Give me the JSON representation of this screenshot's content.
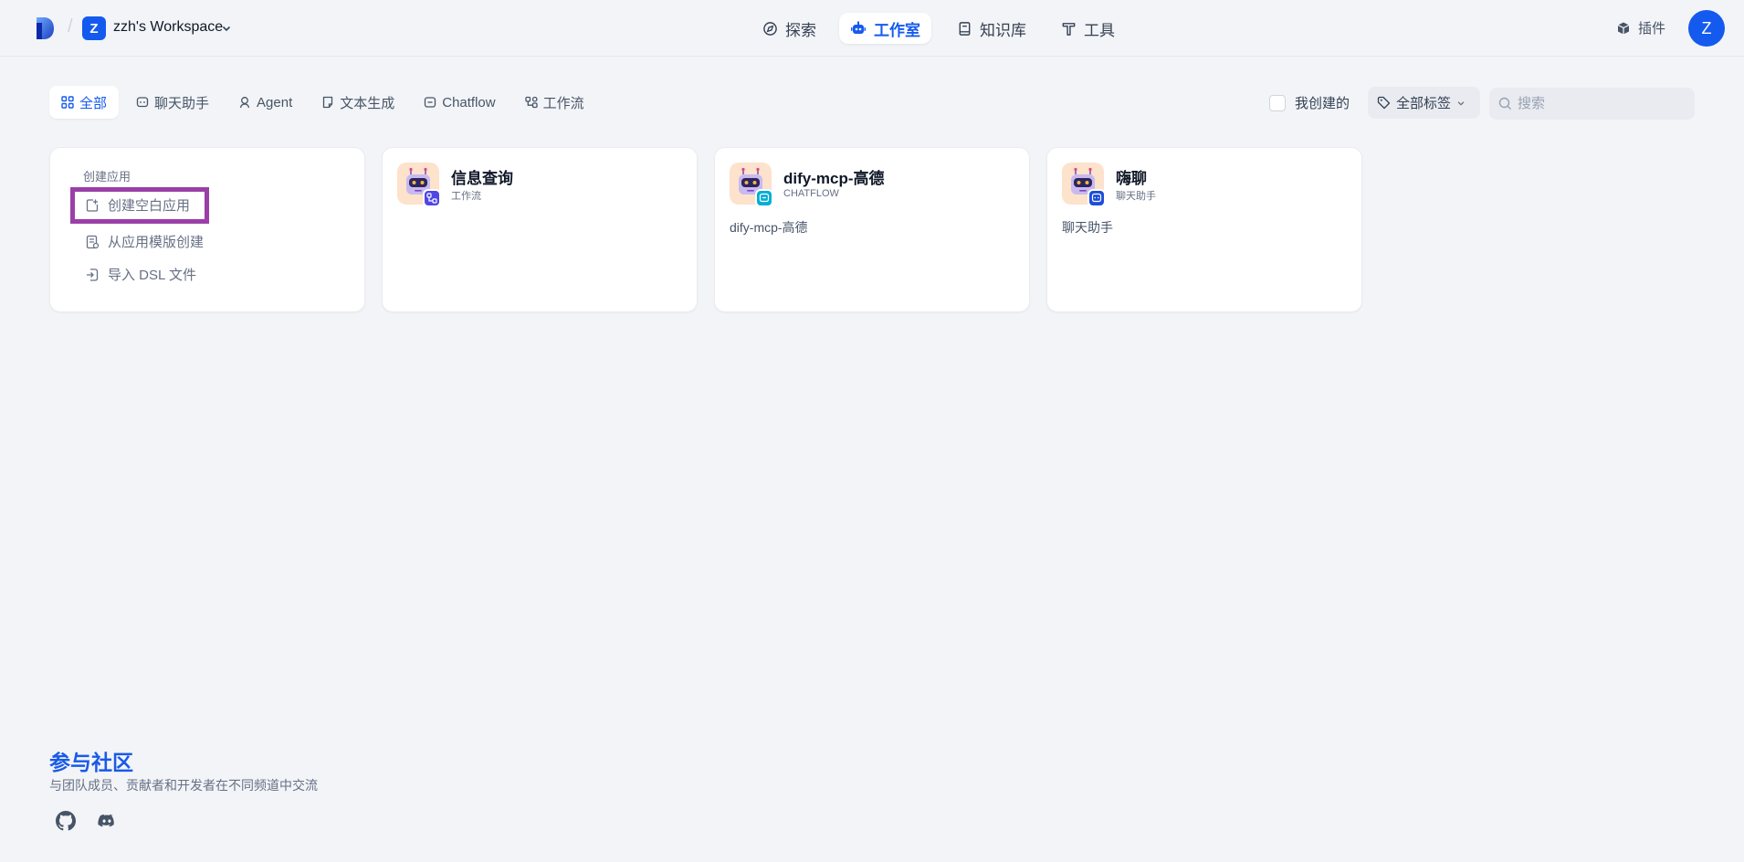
{
  "colors": {
    "accent": "#155aef",
    "background": "#f2f4f7",
    "highlight_border": "#9b3fa8",
    "community_title": "#1a5ae8"
  },
  "header": {
    "workspace_initial": "Z",
    "workspace_name": "zzh's Workspace",
    "nav": [
      {
        "label": "探索",
        "icon": "compass-icon"
      },
      {
        "label": "工作室",
        "icon": "robot-icon",
        "active": true
      },
      {
        "label": "知识库",
        "icon": "book-icon"
      },
      {
        "label": "工具",
        "icon": "hammer-icon"
      }
    ],
    "plugins_label": "插件",
    "user_initial": "Z"
  },
  "filters": {
    "tabs": [
      {
        "label": "全部",
        "icon": "grid-icon",
        "active": true
      },
      {
        "label": "聊天助手",
        "icon": "chat-icon"
      },
      {
        "label": "Agent",
        "icon": "agent-icon"
      },
      {
        "label": "文本生成",
        "icon": "document-icon"
      },
      {
        "label": "Chatflow",
        "icon": "chatflow-icon"
      },
      {
        "label": "工作流",
        "icon": "workflow-icon"
      }
    ],
    "created_by_me_label": "我创建的",
    "created_by_me_checked": false,
    "tag_filter_label": "全部标签",
    "search_placeholder": "搜索",
    "search_value": ""
  },
  "create_card": {
    "heading": "创建应用",
    "items": [
      {
        "label": "创建空白应用",
        "icon": "new-file-icon"
      },
      {
        "label": "从应用模版创建",
        "icon": "template-icon"
      },
      {
        "label": "导入 DSL 文件",
        "icon": "import-icon"
      }
    ]
  },
  "apps": [
    {
      "title": "信息查询",
      "type": "工作流",
      "description": "",
      "badge_color": "#4f46e5",
      "badge_icon": "workflow-badge-icon"
    },
    {
      "title": "dify-mcp-高德",
      "type": "CHATFLOW",
      "description": "dify-mcp-高德",
      "badge_color": "#06aed4",
      "badge_icon": "chatflow-badge-icon"
    },
    {
      "title": "嗨聊",
      "type": "聊天助手",
      "description": "聊天助手",
      "badge_color": "#1d4ed8",
      "badge_icon": "chat-badge-icon"
    }
  ],
  "community": {
    "title": "参与社区",
    "subtitle": "与团队成员、贡献者和开发者在不同频道中交流"
  }
}
